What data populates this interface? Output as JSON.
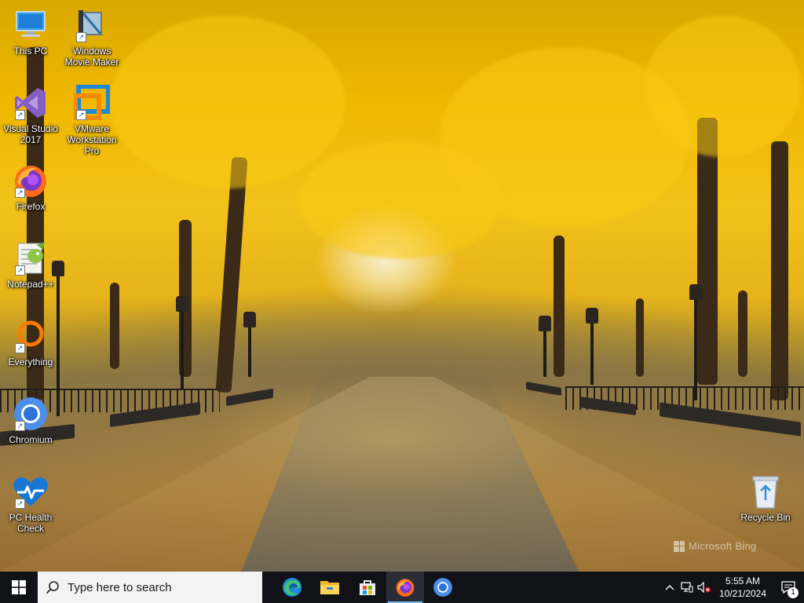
{
  "desktop": {
    "icons": [
      {
        "label": "This PC"
      },
      {
        "label": "Windows Movie Maker"
      },
      {
        "label": "Visual Studio 2017"
      },
      {
        "label": "VMware Workstation Pro"
      },
      {
        "label": "Firefox"
      },
      {
        "label": "Notepad++"
      },
      {
        "label": "Everything"
      },
      {
        "label": "Chromium"
      },
      {
        "label": "PC Health Check"
      },
      {
        "label": "Recycle Bin"
      }
    ],
    "watermark": "Microsoft Bing"
  },
  "taskbar": {
    "search_placeholder": "Type here to search",
    "apps": [
      {
        "name": "edge-icon",
        "active": false
      },
      {
        "name": "file-explorer-icon",
        "active": false
      },
      {
        "name": "microsoft-store-icon",
        "active": false
      },
      {
        "name": "firefox-icon",
        "active": true
      },
      {
        "name": "chromium-icon",
        "active": false
      }
    ],
    "tray": {
      "time": "5:55 AM",
      "date": "10/21/2024",
      "notification_count": "1"
    }
  },
  "colors": {
    "taskbar_bg": "#101218",
    "search_bg": "#f3f3f3",
    "active_indicator": "#76b9ed",
    "windows_blue": "#0078d7"
  }
}
